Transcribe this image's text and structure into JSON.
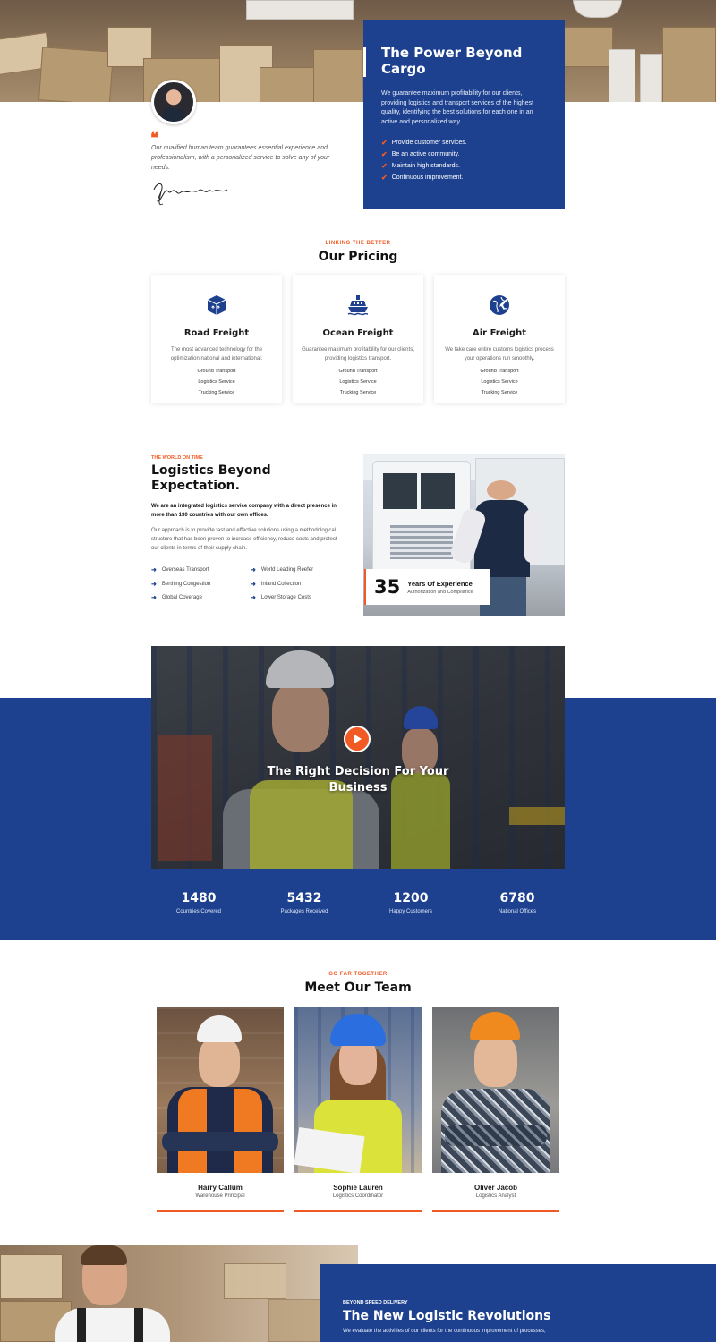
{
  "hero": {
    "title": "The Power Beyond Cargo",
    "description": "We guarantee maximum profitability for our clients, providing logistics and transport services of the highest quality, identifying the best solutions for each one in an active and personalized way.",
    "features": [
      "Provide customer services.",
      "Be an active community.",
      "Maintain high standards.",
      "Continuous improvement."
    ]
  },
  "quote": {
    "mark": "❝",
    "text": "Our qualified human team guarantees essential experience and professionalism, with a personalized service to solve any of your needs."
  },
  "pricing": {
    "kicker": "LINKING THE BETTER",
    "title": "Our Pricing",
    "cards": [
      {
        "icon": "box-icon",
        "title": "Road Freight",
        "description": "The most advanced technology for the optimization national and international.",
        "items": [
          "Ground Transport",
          "Logistics Service",
          "Trucking Service"
        ]
      },
      {
        "icon": "ship-icon",
        "title": "Ocean Freight",
        "description": "Guarantee maximum profitability for our clients, providing logistics transport.",
        "items": [
          "Ground Transport",
          "Logistics Service",
          "Trucking Service"
        ]
      },
      {
        "icon": "globe-plane-icon",
        "title": "Air Freight",
        "description": "We take care entire customs logistics process your operations run smoothly.",
        "items": [
          "Ground Transport",
          "Logistics Service",
          "Trucking Service"
        ]
      }
    ]
  },
  "about": {
    "kicker": "THE WORLD ON TIME",
    "title_line1": "Logistics Beyond",
    "title_line2": "Expectation.",
    "lead": "We are an integrated logistics service company with a direct presence in more than 130 countries with our own offices.",
    "body": "Our approach is to provide fast and effective solutions using a methodological structure that has been proven to increase efficiency, reduce costs and protect our clients in terms of their supply chain.",
    "services": [
      "Overseas Transport",
      "World Leading Reefer",
      "Berthing Congestion",
      "Inland Collection",
      "Global Coverage",
      "Lower Storage Costs"
    ],
    "experience_number": "35",
    "experience_label": "Years Of Experience",
    "experience_sub": "Authorization and Compliance"
  },
  "video": {
    "title_line1": "The Right Decision For Your",
    "title_line2": "Business"
  },
  "stats": [
    {
      "number": "1480",
      "label": "Countries Covered"
    },
    {
      "number": "5432",
      "label": "Packages Received"
    },
    {
      "number": "1200",
      "label": "Happy Customers"
    },
    {
      "number": "6780",
      "label": "National Offices"
    }
  ],
  "team": {
    "kicker": "GO FAR TOGETHER",
    "title": "Meet Our Team",
    "members": [
      {
        "name": "Harry Callum",
        "role": "Warehouse Principal"
      },
      {
        "name": "Sophie Lauren",
        "role": "Logistics Coordinator"
      },
      {
        "name": "Oliver Jacob",
        "role": "Logistics Analyst"
      }
    ]
  },
  "bottom": {
    "kicker": "BEYOND SPEED DELIVERY",
    "title": "The New Logistic Revolutions",
    "text": "We evaluate the activities of our clients for the continuous improvement of processes,"
  },
  "colors": {
    "primary": "#1d418f",
    "accent": "#f15a24"
  }
}
